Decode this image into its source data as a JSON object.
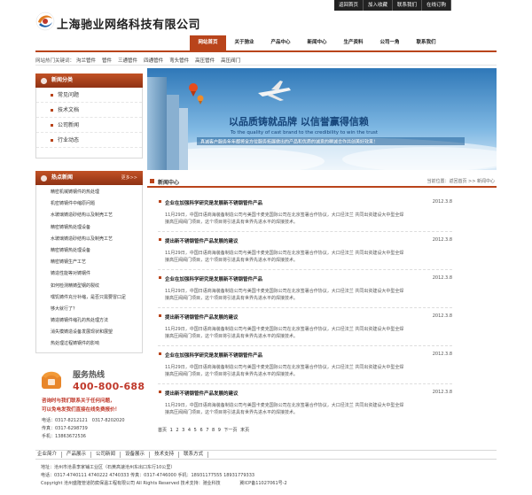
{
  "header": {
    "company_name": "上海驰业网络科技有限公司",
    "top_links": [
      "返回首页",
      "加入收藏",
      "联系我们",
      "在线订购"
    ]
  },
  "nav": {
    "items": [
      "网站首页",
      "关于驰业",
      "产品中心",
      "新闻中心",
      "生产资料",
      "公司一角",
      "联系我们"
    ],
    "active_index": 0
  },
  "hot_keywords": {
    "label": "网站热门关键词：",
    "items": [
      "沟兰管件",
      "管件",
      "三通管件",
      "四通管件",
      "弯头管件",
      "高压管件",
      "高压阀门"
    ]
  },
  "category": {
    "title": "新闻分类",
    "items": [
      "常见问题",
      "技术文档",
      "公司新闻",
      "行业动态"
    ]
  },
  "hot_news": {
    "title": "热点新闻",
    "more": "更多>>",
    "items": [
      "精密机械铸钢件的热处理",
      "机密铸钢件中缩原问题",
      "水玻璃铸造砂结构以及制壳工艺",
      "精密铸钢热处理设备",
      "水玻璃铸造砂结构以及制壳工艺",
      "精密铸钢热处理设备",
      "精密铸钢生产工艺",
      "铸造性能等对铸钢件",
      "如何检测精铸型钢的裂纹",
      "嘿饥铸件充分补缩，是否只需要冒口足",
      "够大就行了？",
      "铸造铸钢件缩孔的热处理方法",
      "消失模铸造设备发展现状和展望",
      "热处理过程铸钢件的影响"
    ]
  },
  "service": {
    "label": "服务热线",
    "number": "400-800-688",
    "promo_line1": "咨询时与我们联系关于任何问题，",
    "promo_line2": "可以免电发我们直接在线免费报价！",
    "phone": "电话：0317-8212121　0317-8202020",
    "fax": "传真：0317-6298739",
    "mobile": "手机：13863672536"
  },
  "banner": {
    "slogan": "以品质铸就品牌 以信誉赢得信赖",
    "slogan_en": "To the quality of cast brand to the credibility to win the trust",
    "sub": "真诚客户服务年年都将全方位服务拓展做出的产品和优质的诚意的精诚合作共创美好效果！"
  },
  "news": {
    "title": "新闻中心",
    "breadcrumb": "当前位置：返回首页 >> 新闻中心",
    "items": [
      {
        "title": "企业在加强科学研究是发展新不锈钢管件产品",
        "date": "2012.3.8",
        "summary": "11月29日，中国日语商海装备制造公司与美国卡麦克国际公司在北京签署合作协议，大口径法兰 共同出资建设大中型全焊接高压阀阀门项目，这个项目将引进具有世界先进水平的焊接技术。"
      },
      {
        "title": "提出新不锈钢管件产品发展的建议",
        "date": "2012.3.8",
        "summary": "11月29日，中国日语商海装备制造公司与美国卡麦克国际公司在北京签署合作协议，大口径法兰 共同出资建设大中型全焊接高压阀阀门项目，这个项目将引进具有世界先进水平的焊接技术。"
      },
      {
        "title": "企业在加强科学研究是发展新不锈钢管件产品",
        "date": "2012.3.8",
        "summary": "11月29日，中国日语商海装备制造公司与美国卡麦克国际公司在北京签署合作协议，大口径法兰 共同出资建设大中型全焊接高压阀阀门项目，这个项目将引进具有世界先进水平的焊接技术。"
      },
      {
        "title": "提出新不锈钢管件产品发展的建议",
        "date": "2012.3.8",
        "summary": "11月29日，中国日语商海装备制造公司与美国卡麦克国际公司在北京签署合作协议，大口径法兰 共同出资建设大中型全焊接高压阀阀门项目，这个项目将引进具有世界先进水平的焊接技术。"
      },
      {
        "title": "企业在加强科学研究是发展新不锈钢管件产品",
        "date": "2012.3.8",
        "summary": "11月29日，中国日语商海装备制造公司与美国卡麦克国际公司在北京签署合作协议，大口径法兰 共同出资建设大中型全焊接高压阀阀门项目，这个项目将引进具有世界先进水平的焊接技术。"
      },
      {
        "title": "提出新不锈钢管件产品发展的建议",
        "date": "2012.3.8",
        "summary": "11月29日，中国日语商海装备制造公司与美国卡麦克国际公司在北京签署合作协议，大口径法兰 共同出资建设大中型全焊接高压阀阀门项目，这个项目将引进具有世界先进水平的焊接技术。"
      }
    ],
    "pager": "首页 1 2 3 4 5 6 7 8 9 下一页 末页"
  },
  "footer": {
    "links": [
      "企业简介",
      "产品展示",
      "公司新闻",
      "设备展示",
      "技术支持",
      "联系方式"
    ],
    "address": "地址：沧州市沧县李家铺工业区（石黄高速沧州东出口东行10公里）",
    "contact": "电话：0317-4740111 4740222 4740333 传真：0317-4746000 手机：18931177555 18931779333",
    "copyright": "Copyright 沧州盛隆管道防腐保温工程有限公司 All Rights Reserved 技术支持：驰业科技",
    "icp": "冀ICP备11027061号-2"
  },
  "colors": {
    "accent": "#b9441b",
    "dark_bar": "#222222",
    "service_red": "#c0392b"
  }
}
